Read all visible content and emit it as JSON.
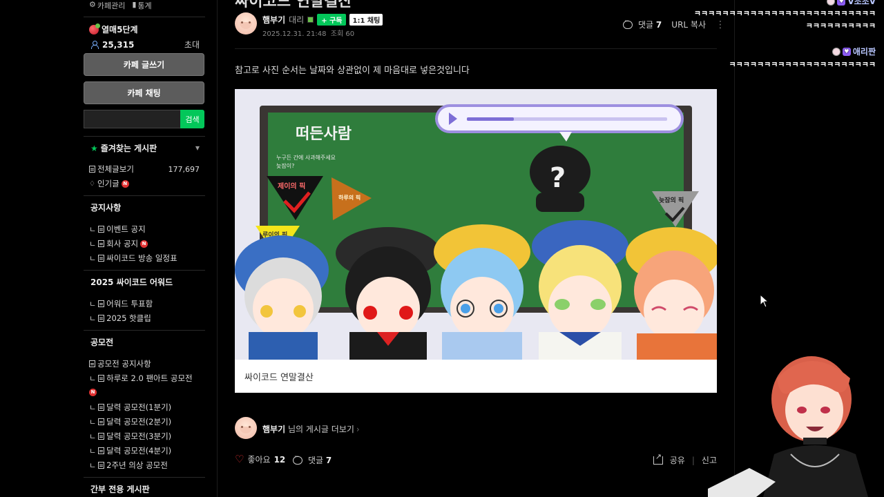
{
  "sidebar": {
    "cafe_manage": "카페관리",
    "stats": "통계",
    "level": "열매5단계",
    "member_count": "25,315",
    "invite": "초대",
    "write_button": "카페 글쓰기",
    "chat_button": "카페 채팅",
    "search_button": "검색",
    "favorites_title": "즐겨찾는 게시판",
    "all_posts": "전체글보기",
    "all_posts_count": "177,697",
    "popular": "인기글",
    "new_badge": "N",
    "sections": [
      {
        "title": "공지사항",
        "items": [
          "이벤트 공지",
          "회사 공지",
          "싸이코드 방송 일정표"
        ]
      },
      {
        "title": "2025 싸이코드 어워드",
        "items": [
          "어워드 투표함",
          "2025 핫클립"
        ]
      },
      {
        "title": "공모전",
        "items": [
          "공모전 공지사항",
          "하루로 2.0 팬아트 공모전",
          "달력 공모전(1분기)",
          "달력 공모전(2분기)",
          "달력 공모전(3분기)",
          "달력 공모전(4분기)",
          "2주년 의상 공모전"
        ]
      },
      {
        "title": "간부 전용 게시판",
        "items": []
      }
    ]
  },
  "post": {
    "title_peek": "싸이코드 연말결산",
    "author": "햄부기",
    "grade": "대리",
    "subscribe": "+ 구독",
    "chat_1to1": "1:1 채팅",
    "date": "2025.12.31. 21:48",
    "views": "조회 60",
    "comments_label": "댓글",
    "comments_count": "7",
    "url_copy": "URL 복사",
    "body": "참고로 사진 순서는 날짜와 상관없이 제 마음대로 넣은것입니다",
    "image_caption": "싸이코드 연말결산",
    "image_texts": {
      "board_title": "떠든사람",
      "board_sub1": "누구든 간에 사과해주세요",
      "board_sub2": "늦잠이?",
      "flag1": "제이의 픽",
      "flag2": "하루의 픽",
      "flag3": "루이의 픽",
      "flag4": "늦잠의 픽"
    },
    "more_author": "햄부기",
    "more_text": "님의 게시글 더보기",
    "like_label": "좋아요",
    "like_count": "12",
    "share": "공유",
    "report": "신고"
  },
  "chat": {
    "line1": "ㅋㅋㅋㅋㅋㅋㅋㅋㅋㅋㅋㅋㅋㅋㅋㅋㅋㅋㅋㅋㅋㅋㅋㅋㅋㅋ",
    "line2": "ㅋㅋㅋㅋㅋㅋㅋㅋㅋㅋ",
    "user2": "애리짠",
    "line3": "ㅋㅋㅋㅋㅋㅋㅋㅋㅋㅋㅋㅋㅋㅋㅋㅋㅋㅋㅋㅋㅋ",
    "user1_partial": "V조조V"
  },
  "colors": {
    "accent_green": "#03c75a",
    "new_red": "#e03131",
    "background": "#000000",
    "button_gray": "#5c5c5c"
  }
}
